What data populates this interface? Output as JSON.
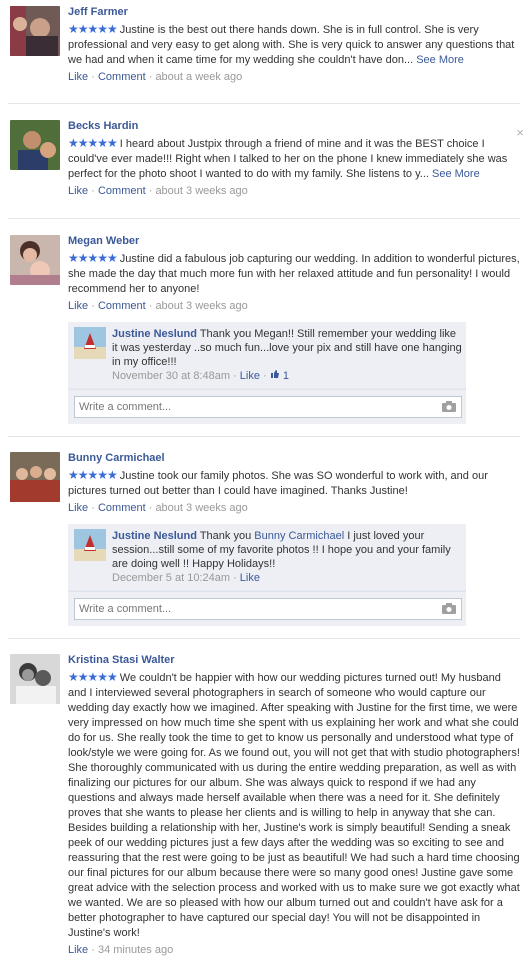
{
  "reviews": [
    {
      "name": "Jeff Farmer",
      "stars": "★★★★★",
      "text": "Justine is the best out there hands down. She is in full control. She is very professional and very easy to get along with. She is very quick to answer any questions that we had and when it came time for my wedding she couldn't have don...",
      "see_more": "See More",
      "like": "Like",
      "comment": "Comment",
      "time": "about a week ago"
    },
    {
      "name": "Becks Hardin",
      "stars": "★★★★★",
      "text": "I heard about Justpix through a friend of mine and it was the BEST choice I could've ever made!!! Right when I talked to her on the phone I knew immediately she was perfect for the photo shoot I wanted to do with my family. She listens to y...",
      "see_more": "See More",
      "like": "Like",
      "comment": "Comment",
      "time": "about 3 weeks ago"
    },
    {
      "name": "Megan Weber",
      "stars": "★★★★★",
      "text": "Justine did a fabulous job capturing our wedding. In addition to wonderful pictures, she made the day that much more fun with her relaxed attitude and fun personality! I would recommend her to anyone!",
      "like": "Like",
      "comment": "Comment",
      "time": "about 3 weeks ago",
      "reply": {
        "name": "Justine Neslund",
        "text": "Thank you Megan!! Still remember your wedding like it was yesterday ..so much fun...love your pix and still have one hanging in my office!!!",
        "date": "November 30 at 8:48am",
        "like": "Like",
        "likes_count": "1"
      },
      "composer_placeholder": "Write a comment..."
    },
    {
      "name": "Bunny Carmichael",
      "stars": "★★★★★",
      "text": "Justine took our family photos. She was SO wonderful to work with, and our pictures turned out better than I could have imagined. Thanks Justine!",
      "like": "Like",
      "comment": "Comment",
      "time": "about 3 weeks ago",
      "reply": {
        "name": "Justine Neslund",
        "text_before": "Thank you",
        "mention": "Bunny Carmichael",
        "text_after": "I just loved your session...still some of my favorite photos !! I hope you and your family are doing well !! Happy Holidays!!",
        "date": "December 5 at 10:24am",
        "like": "Like"
      },
      "composer_placeholder": "Write a comment..."
    },
    {
      "name": "Kristina Stasi Walter",
      "stars": "★★★★★",
      "text": "We couldn't be happier with how our wedding pictures turned out! My husband and I interviewed several photographers in search of someone who would capture our wedding day exactly how we imagined. After speaking with Justine for the first time, we were very impressed on how much time she spent with us explaining her work and what she could do for us. She really took the time to get to know us personally and understood what type of look/style we were going for. As we found out, you will not get that with studio photographers! She thoroughly communicated with us during the entire wedding preparation, as well as with finalizing our pictures for our album. She was always quick to respond if we had any questions and always made herself available when there was a need for it. She definitely proves that she wants to please her clients and is willing to help in anyway that she can. Besides building a relationship with her, Justine's work is simply beautiful! Sending a sneak peek of our wedding pictures just a few days after the wedding was so exciting to see and reassuring that the rest were going to be just as beautiful! We had such a hard time choosing our final pictures for our album because there were so many good ones! Justine gave some great advice with the selection process and worked with us to make sure we got exactly what we wanted. We are so pleased with how our album turned out and couldn't have ask for a better photographer to have captured our special day! You will not be disappointed in Justine's work!",
      "like": "Like",
      "time": "34 minutes ago"
    }
  ],
  "close_icon": "×",
  "icons": {
    "star": "star-icon",
    "thumb": "thumbs-up-icon",
    "camera": "camera-icon",
    "close": "close-icon"
  },
  "colors": {
    "link": "#3b5998",
    "star": "#3b6cd4",
    "reply_bg": "#edeff4",
    "meta": "#999999"
  }
}
